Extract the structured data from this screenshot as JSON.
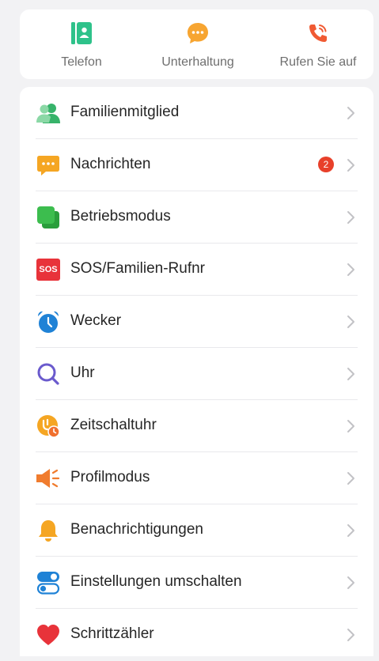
{
  "quick_actions": {
    "phone": {
      "label": "Telefon",
      "icon": "phone-book-icon",
      "color": "#2ec28a"
    },
    "chat": {
      "label": "Unterhaltung",
      "icon": "chat-bubble-icon",
      "color": "#f7a531"
    },
    "call": {
      "label": "Rufen Sie auf",
      "icon": "ringing-phone-icon",
      "color": "#f05a33"
    }
  },
  "menu": {
    "items": [
      {
        "label": "Familienmitglied",
        "icon": "family-members-icon",
        "color": "#37b36a"
      },
      {
        "label": "Nachrichten",
        "icon": "message-icon",
        "color": "#f5a623",
        "badge": "2"
      },
      {
        "label": "Betriebsmodus",
        "icon": "operating-mode-icon",
        "color": "#3cbd4e"
      },
      {
        "label": "SOS/Familien-Rufnr",
        "icon": "sos-icon",
        "color": "#e8333a",
        "icon_text": "SOS"
      },
      {
        "label": "Wecker",
        "icon": "alarm-clock-icon",
        "color": "#1f82d6"
      },
      {
        "label": "Uhr",
        "icon": "search-icon",
        "color": "#6a5acd"
      },
      {
        "label": "Zeitschaltuhr",
        "icon": "timer-icon",
        "color": "#f5a623"
      },
      {
        "label": "Profilmodus",
        "icon": "speaker-icon",
        "color": "#f07c2e"
      },
      {
        "label": "Benachrichtigungen",
        "icon": "bell-icon",
        "color": "#f5a623"
      },
      {
        "label": "Einstellungen umschalten",
        "icon": "toggle-switch-icon",
        "color": "#1f82d6"
      },
      {
        "label": "Schrittzähler",
        "icon": "heart-icon",
        "color": "#e8333a"
      }
    ]
  }
}
